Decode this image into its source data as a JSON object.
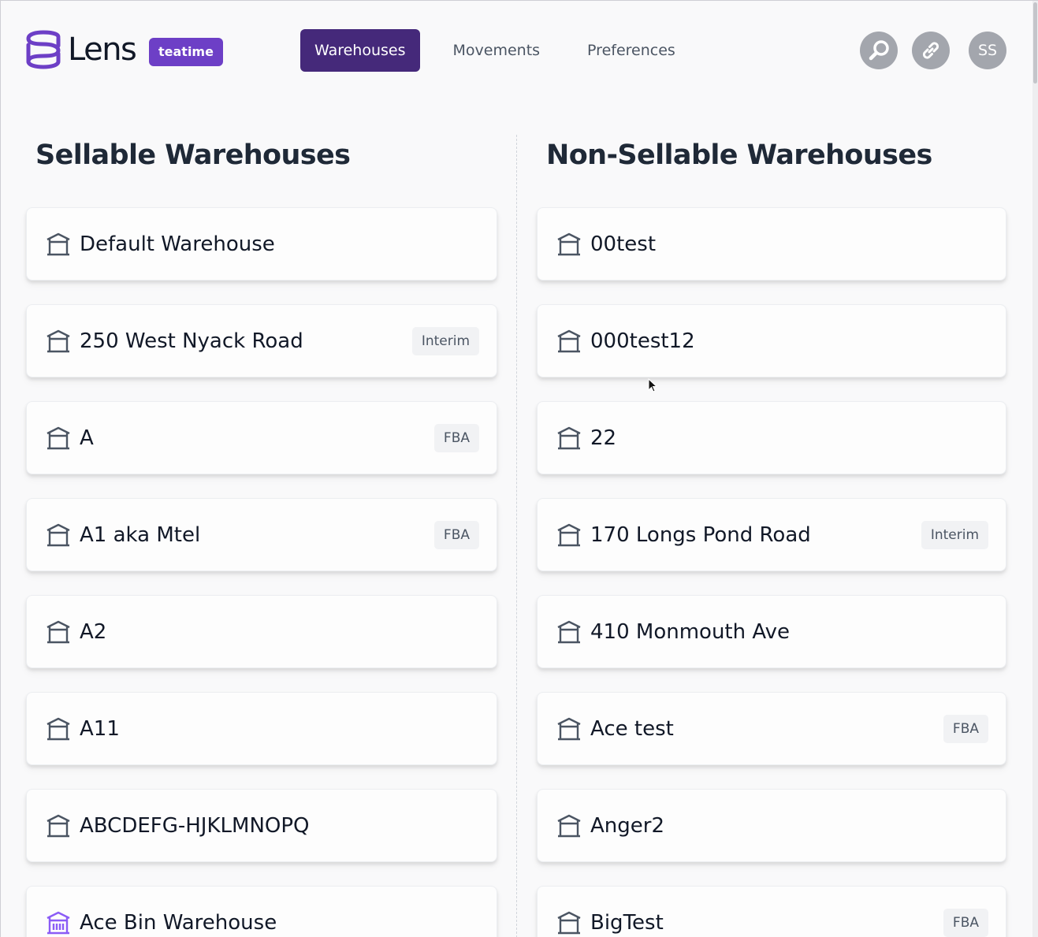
{
  "app": {
    "name": "Lens",
    "tenant": "teatime",
    "brand_color": "#6d3fc6",
    "active_nav_color": "#45297a"
  },
  "nav": [
    {
      "label": "Warehouses",
      "active": true
    },
    {
      "label": "Movements",
      "active": false
    },
    {
      "label": "Preferences",
      "active": false
    }
  ],
  "header_actions": {
    "search_icon": "search-icon",
    "link_icon": "link-icon",
    "avatar_initials": "SS"
  },
  "sellable": {
    "title": "Sellable Warehouses",
    "items": [
      {
        "name": "Default Warehouse",
        "tag": "",
        "icon": "warehouse-icon"
      },
      {
        "name": "250 West Nyack Road",
        "tag": "Interim",
        "icon": "warehouse-icon"
      },
      {
        "name": "A",
        "tag": "FBA",
        "icon": "warehouse-icon"
      },
      {
        "name": "A1 aka Mtel",
        "tag": "FBA",
        "icon": "warehouse-icon"
      },
      {
        "name": "A2",
        "tag": "",
        "icon": "warehouse-icon"
      },
      {
        "name": "A11",
        "tag": "",
        "icon": "warehouse-icon"
      },
      {
        "name": "ABCDEFG-HJKLMNOPQ",
        "tag": "",
        "icon": "warehouse-icon"
      },
      {
        "name": "Ace Bin Warehouse",
        "tag": "",
        "icon": "bin-warehouse-icon"
      }
    ]
  },
  "non_sellable": {
    "title": "Non-Sellable Warehouses",
    "items": [
      {
        "name": "00test",
        "tag": "",
        "icon": "warehouse-icon"
      },
      {
        "name": "000test12",
        "tag": "",
        "icon": "warehouse-icon"
      },
      {
        "name": "22",
        "tag": "",
        "icon": "warehouse-icon"
      },
      {
        "name": "170 Longs Pond Road",
        "tag": "Interim",
        "icon": "warehouse-icon"
      },
      {
        "name": "410 Monmouth Ave",
        "tag": "",
        "icon": "warehouse-icon"
      },
      {
        "name": "Ace test",
        "tag": "FBA",
        "icon": "warehouse-icon"
      },
      {
        "name": "Anger2",
        "tag": "",
        "icon": "warehouse-icon"
      },
      {
        "name": "BigTest",
        "tag": "FBA",
        "icon": "warehouse-icon"
      }
    ]
  }
}
